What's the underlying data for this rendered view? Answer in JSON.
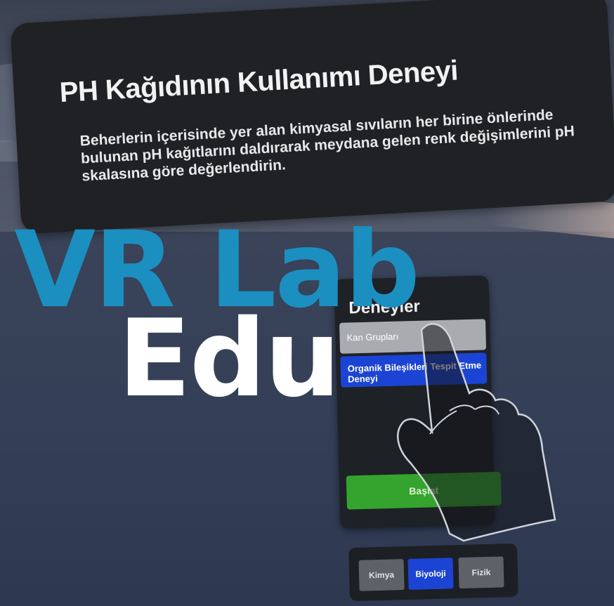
{
  "info_panel": {
    "title": "PH Kağıdının Kullanımı Deneyi",
    "description": "Beherlerin içerisinde yer alan kimyasal sıvıların her birine önlerinde bulunan pH kağıtlarını daldırarak meydana gelen renk değişimlerini pH skalasına göre değerlendirin."
  },
  "logo": {
    "line1": "VR Lab",
    "line2": "Edu",
    "colors": {
      "line1": "#1b8fc0",
      "line2": "#ffffff"
    }
  },
  "experiment_menu": {
    "title": "Deneyler",
    "items": [
      {
        "label": "Kan Grupları",
        "state": "default"
      },
      {
        "label": "Organik Bileşikleri Tespit Etme Deneyi",
        "state": "selected"
      }
    ],
    "start_label": "Başlat",
    "colors": {
      "selected": "#1c44d4",
      "start": "#34a42e"
    }
  },
  "category_tabs": [
    {
      "label": "Kimya",
      "active": false
    },
    {
      "label": "Biyoloji",
      "active": true
    },
    {
      "label": "Fizik",
      "active": false
    }
  ]
}
